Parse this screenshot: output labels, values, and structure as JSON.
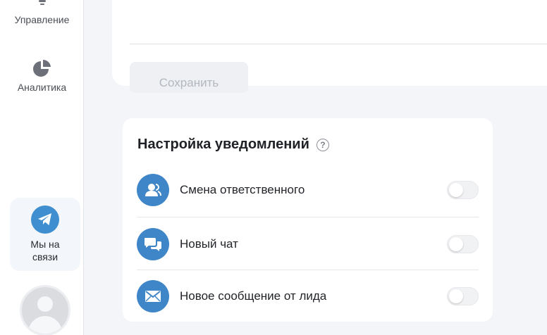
{
  "sidebar": {
    "items": [
      {
        "label": "Управление",
        "icon": "lightbulb-icon"
      },
      {
        "label": "Аналитика",
        "icon": "pie-chart-icon"
      }
    ],
    "contact": {
      "label": "Мы на связи",
      "icon": "telegram-icon",
      "color": "#3f8fd0"
    },
    "avatar": {
      "icon": "user-avatar-icon"
    }
  },
  "main": {
    "save_label": "Сохранить",
    "notifications": {
      "title": "Настройка уведомлений",
      "help_icon": "question-circle-icon",
      "items": [
        {
          "label": "Смена ответственного",
          "icon": "users-icon",
          "enabled": false
        },
        {
          "label": "Новый чат",
          "icon": "chat-bubbles-icon",
          "enabled": false
        },
        {
          "label": "Новое сообщение от лида",
          "icon": "envelope-icon",
          "enabled": false
        }
      ]
    }
  },
  "colors": {
    "accent": "#3f86c8",
    "background": "#f4f5f8"
  }
}
